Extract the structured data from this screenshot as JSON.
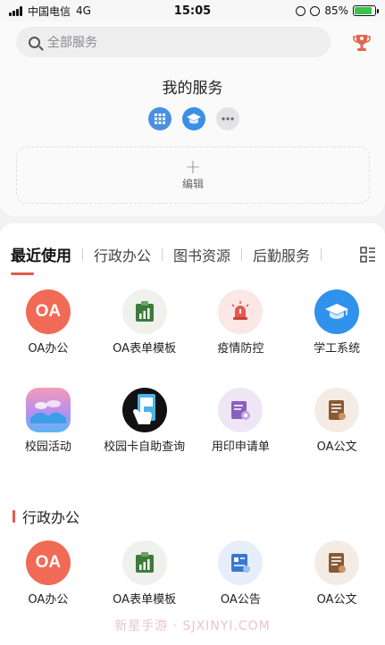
{
  "status_bar": {
    "carrier": "中国电信",
    "network": "4G",
    "time": "15:05",
    "battery": "85%",
    "battery_level": 0.85
  },
  "search": {
    "placeholder": "全部服务"
  },
  "my_services": {
    "title": "我的服务",
    "icons": [
      "building-icon",
      "graduation-cap-icon",
      "more-icon"
    ],
    "edit_label": "编辑"
  },
  "tabs": [
    "最近使用",
    "行政办公",
    "图书资源",
    "后勤服务"
  ],
  "recent_apps": [
    {
      "label": "OA办公",
      "icon": "oa-icon",
      "text": "OA"
    },
    {
      "label": "OA表单模板",
      "icon": "chart-board-icon"
    },
    {
      "label": "疫情防控",
      "icon": "alarm-light-icon"
    },
    {
      "label": "学工系统",
      "icon": "graduation-cap-icon"
    },
    {
      "label": "校园活动",
      "icon": "landscape-icon"
    },
    {
      "label": "校园卡自助查询",
      "icon": "card-hand-icon"
    },
    {
      "label": "用印申请单",
      "icon": "seal-form-icon"
    },
    {
      "label": "OA公文",
      "icon": "document-icon"
    }
  ],
  "section": {
    "title": "行政办公"
  },
  "admin_apps": [
    {
      "label": "OA办公",
      "icon": "oa-icon",
      "text": "OA"
    },
    {
      "label": "OA表单模板",
      "icon": "chart-board-icon"
    },
    {
      "label": "OA公告",
      "icon": "notice-icon"
    },
    {
      "label": "OA公文",
      "icon": "document-icon"
    }
  ],
  "watermark": "新星手游 · SJXINYI.COM",
  "colors": {
    "accent": "#e25b4a",
    "blue": "#3a8fe6"
  }
}
